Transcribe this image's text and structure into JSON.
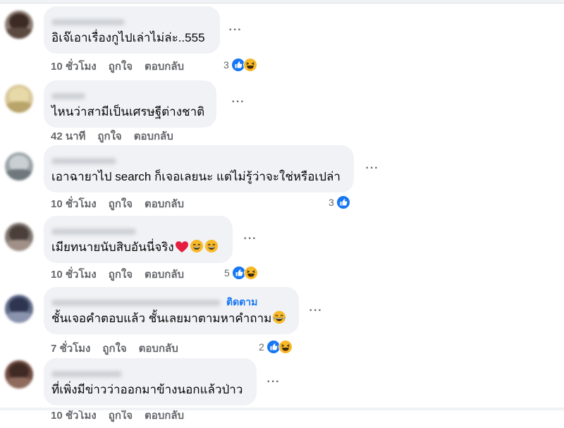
{
  "comments": [
    {
      "text": "อิเจ๊เอาเรื่องกูไปเล่าไม่ล่ะ..555",
      "time": "10 ชั่วโมง",
      "like": "ถูกใจ",
      "reply": "ตอบกลับ",
      "reaction_count": "3",
      "reactions": [
        "like-icon",
        "haha-icon"
      ],
      "follow": ""
    },
    {
      "text": "ไหนว่าสามีเป็นเศรษฐีต่างชาติ",
      "time": "42 นาที",
      "like": "ถูกใจ",
      "reply": "ตอบกลับ",
      "reaction_count": "",
      "reactions": [],
      "follow": ""
    },
    {
      "text": "เอาฉายาไป search ก็เจอเลยนะ แต่ไม่รู้ว่าจะใช่หรือเปล่า",
      "time": "10 ชั่วโมง",
      "like": "ถูกใจ",
      "reply": "ตอบกลับ",
      "reaction_count": "3",
      "reactions": [
        "like-icon"
      ],
      "follow": ""
    },
    {
      "text": "เมียทนายนับสิบอันนี่จริง",
      "time": "10 ชั่วโมง",
      "like": "ถูกใจ",
      "reply": "ตอบกลับ",
      "reaction_count": "5",
      "reactions": [
        "like-icon",
        "haha-icon"
      ],
      "follow": "",
      "inline_emojis": [
        "heart-emoji",
        "smile-emoji",
        "smile-emoji"
      ]
    },
    {
      "text": "ชั้นเจอคำตอบแล้ว ชั้นเลยมาตามหาคำถาม",
      "time": "7 ชั่วโมง",
      "like": "ถูกใจ",
      "reply": "ตอบกลับ",
      "reaction_count": "2",
      "reactions": [
        "like-icon",
        "haha-icon"
      ],
      "follow": "ติดตาม",
      "inline_emojis": [
        "tears-of-joy-emoji"
      ]
    },
    {
      "text": "ที่เพิ่งมีข่าวว่าออกมาข้างนอกแล้วป่าว",
      "time": "10 ชั่วโมง",
      "like": "ถูกใจ",
      "reply": "ตอบกลับ",
      "reaction_count": "",
      "reactions": [],
      "follow": ""
    }
  ],
  "more_icon": "more-horizontal-icon",
  "colors": {
    "bubble": "#f0f2f5",
    "text": "#050505",
    "meta": "#65676b",
    "like_blue": "#1877f2",
    "haha_yellow": "#f7b928",
    "heart_red": "#e41e3f"
  }
}
